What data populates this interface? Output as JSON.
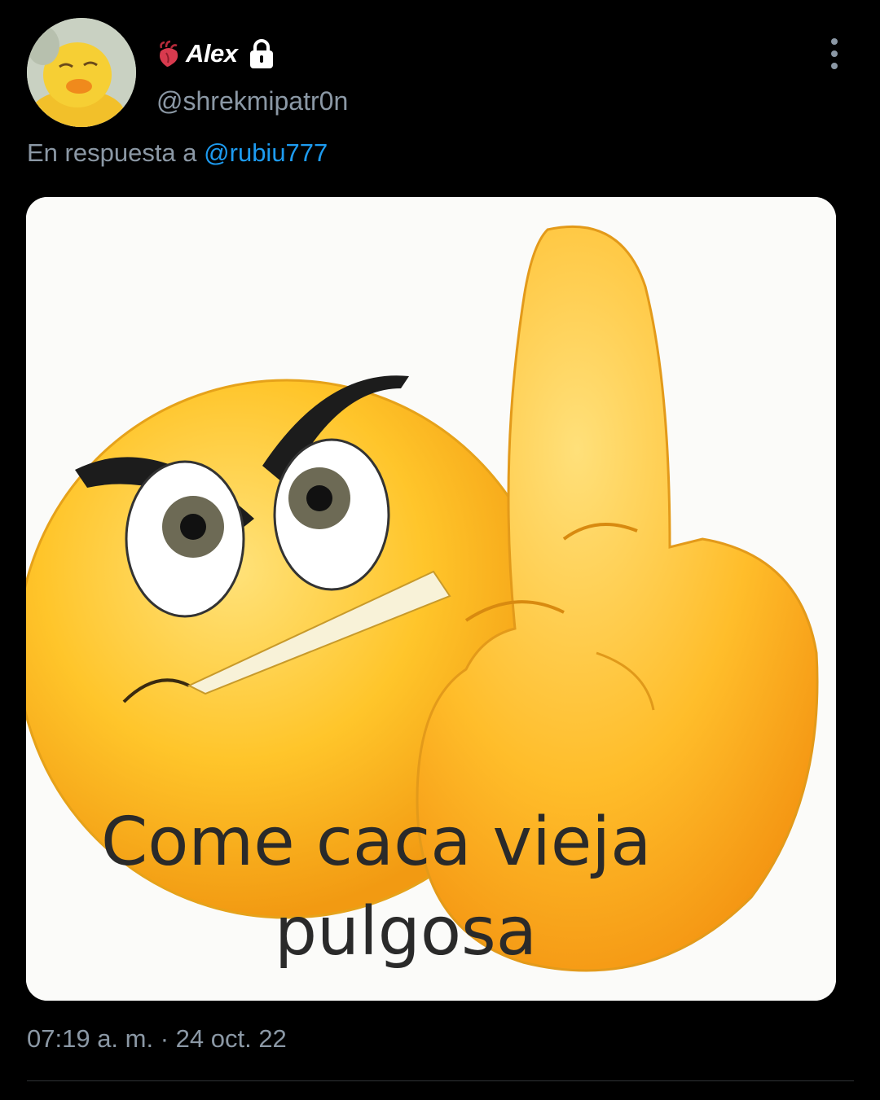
{
  "tweet": {
    "author_name": "Alex",
    "author_handle": "@shrekmipatr0n",
    "reply_prefix": "En respuesta a",
    "reply_to": "@rubiu777",
    "timestamp": "07:19 a. m. · 24 oct. 22"
  },
  "media": {
    "caption_line1": "Come caca vieja",
    "caption_line2": "pulgosa"
  },
  "icons": {
    "name_prefix": "anatomical-heart-icon",
    "name_suffix": "lock-icon",
    "menu": "more-vertical-icon"
  },
  "colors": {
    "background": "#000000",
    "link": "#1d9bf0",
    "muted": "#8b98a5"
  }
}
